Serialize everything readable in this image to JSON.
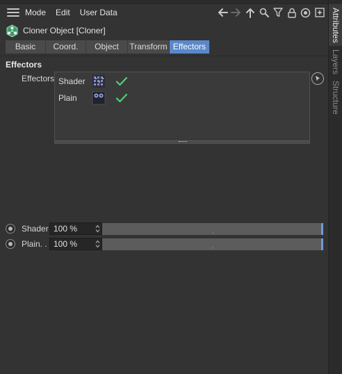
{
  "menubar": {
    "items": [
      "Mode",
      "Edit",
      "User Data"
    ],
    "icons": [
      "arrow-left-icon",
      "arrow-right-icon",
      "arrow-up-icon",
      "search-icon",
      "filter-icon",
      "lock-icon",
      "target-icon",
      "add-panel-icon"
    ]
  },
  "object": {
    "title": "Cloner Object [Cloner]",
    "icon": "cloner-icon"
  },
  "tabs": [
    {
      "label": "Basic",
      "active": false
    },
    {
      "label": "Coord.",
      "active": false
    },
    {
      "label": "Object",
      "active": false
    },
    {
      "label": "Transform",
      "active": false
    },
    {
      "label": "Effectors",
      "active": true
    }
  ],
  "section": {
    "title": "Effectors",
    "field_label": "Effectors"
  },
  "effectors": [
    {
      "name": "Shader",
      "icon": "shader-effector-icon",
      "enabled": true
    },
    {
      "name": "Plain",
      "icon": "plain-effector-icon",
      "enabled": true
    }
  ],
  "strengths": [
    {
      "label": "Shader",
      "value": "100 %",
      "fraction": 1.0
    },
    {
      "label": "Plain. .",
      "value": "100 %",
      "fraction": 1.0
    }
  ],
  "right_tabs": [
    {
      "label": "Attributes",
      "active": true
    },
    {
      "label": "Layers",
      "active": false
    },
    {
      "label": "Structure",
      "active": false
    }
  ],
  "colors": {
    "accent": "#5a88c9",
    "check": "#4fd07a",
    "background": "#333333"
  }
}
